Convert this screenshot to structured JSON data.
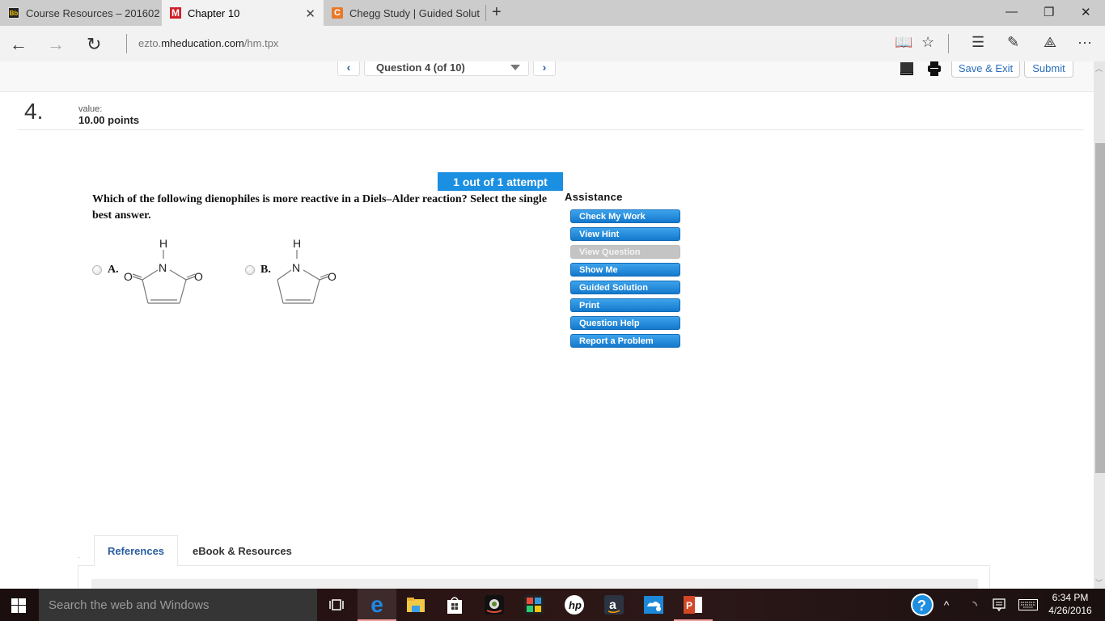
{
  "browser": {
    "tabs": [
      {
        "label": "Course Resources – 201602",
        "favicon": "Bb",
        "active": false
      },
      {
        "label": "Chapter 10",
        "favicon": "M",
        "active": true
      },
      {
        "label": "Chegg Study | Guided Solut",
        "favicon": "C",
        "active": false
      }
    ],
    "new_tab_icon": "+",
    "url_prefix": "ezto.",
    "url_domain": "mheducation.com",
    "url_path": "/hm.tpx",
    "toolbar_icons": [
      "reading-view-icon",
      "favorite-star-icon",
      "hub-icon",
      "web-note-icon",
      "share-icon",
      "more-icon"
    ],
    "window_controls": [
      "minimize",
      "restore",
      "close"
    ]
  },
  "quiz_header": {
    "question_select": "Question 4 (of 10)",
    "save_exit": "Save & Exit",
    "submit": "Submit"
  },
  "question": {
    "number": "4.",
    "value_label": "value:",
    "points": "10.00 points",
    "attempts": "1 out of 1 attempt",
    "text": "Which of the following dienophiles is more reactive in a Diels–Alder reaction? Select the single best answer.",
    "options": [
      {
        "label": "A.",
        "molecule": "maleimide",
        "atoms": {
          "h": "H",
          "n": "N",
          "o_left": "O",
          "o_right": "O"
        }
      },
      {
        "label": "B.",
        "molecule": "3-pyrrolin-2-one",
        "atoms": {
          "h": "H",
          "n": "N",
          "o_right": "O"
        }
      }
    ]
  },
  "assistance": {
    "title": "Assistance",
    "buttons": [
      {
        "label": "Check My Work",
        "enabled": true
      },
      {
        "label": "View Hint",
        "enabled": true
      },
      {
        "label": "View Question",
        "enabled": false
      },
      {
        "label": "Show Me",
        "enabled": true
      },
      {
        "label": "Guided Solution",
        "enabled": true
      },
      {
        "label": "Print",
        "enabled": true
      },
      {
        "label": "Question Help",
        "enabled": true
      },
      {
        "label": "Report a Problem",
        "enabled": true
      }
    ]
  },
  "reference_tabs": {
    "active": "References",
    "other": "eBook & Resources"
  },
  "taskbar": {
    "search_placeholder": "Search the web and Windows",
    "time": "6:34 PM",
    "date": "4/26/2016",
    "pinned_apps": [
      "task-view",
      "edge",
      "file-explorer",
      "store",
      "webcam",
      "puzzle-app",
      "hp",
      "amazon",
      "onedrive",
      "powerpoint"
    ]
  },
  "colors": {
    "accent_blue": "#1b8fe1",
    "link_blue": "#2a5d9f",
    "disabled_gray": "#c4c4c4"
  }
}
